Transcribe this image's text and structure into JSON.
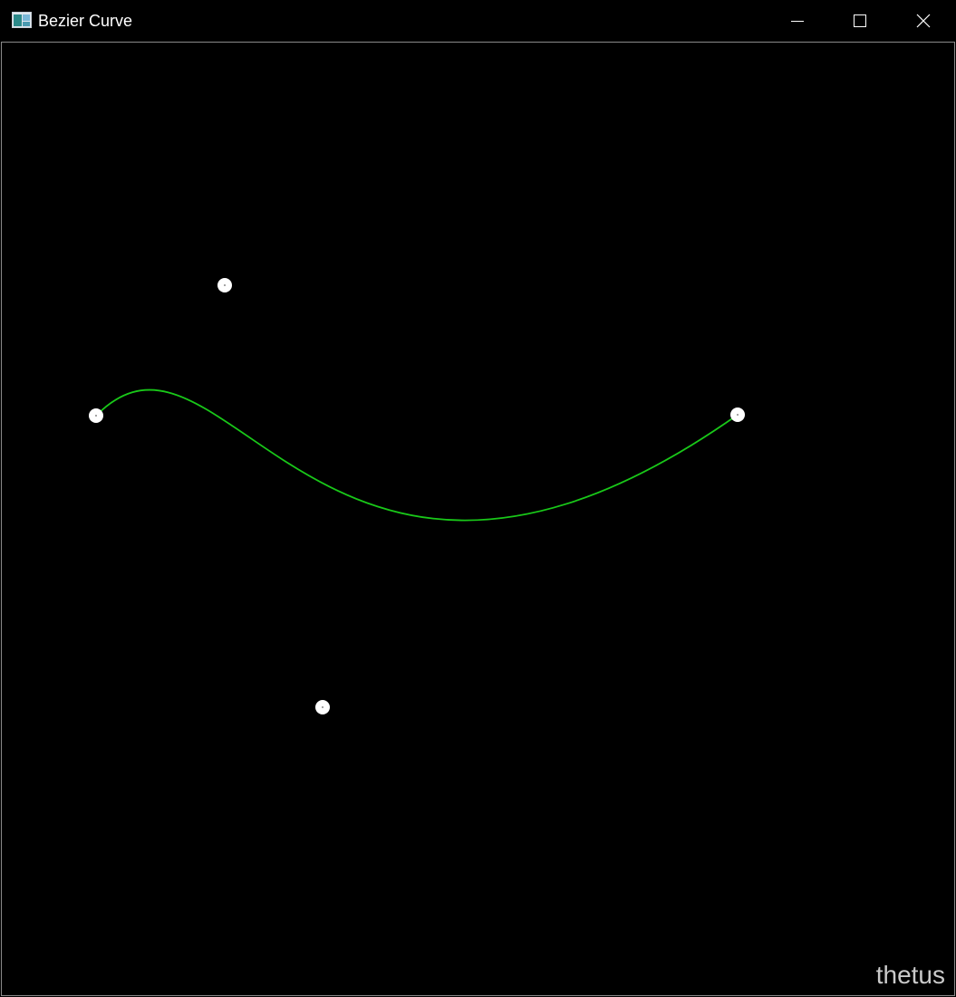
{
  "window": {
    "title": "Bezier Curve",
    "controls": {
      "minimize": "minimize",
      "maximize": "maximize",
      "close": "close"
    }
  },
  "colors": {
    "curve": "#19c819",
    "control_point": "#ffffff",
    "background": "#000000"
  },
  "watermark": "thetus"
}
